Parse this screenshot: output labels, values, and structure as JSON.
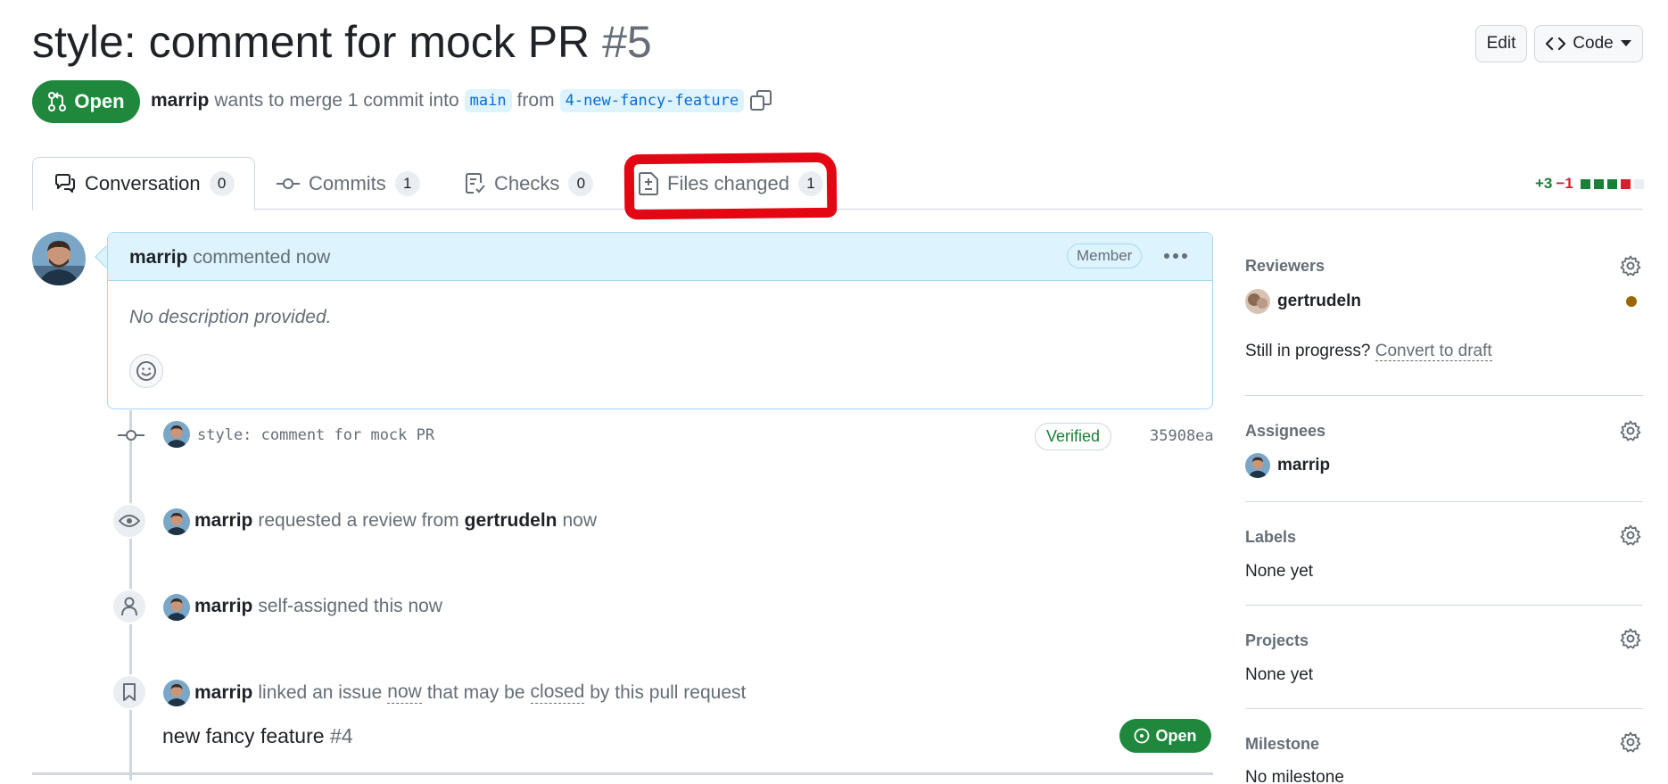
{
  "header": {
    "title": "style: comment for mock PR",
    "number": "#5",
    "edit_label": "Edit",
    "code_label": "Code",
    "state": "Open",
    "author": "marrip",
    "merge_text": "wants to merge 1 commit into",
    "base_branch": "main",
    "from_text": "from",
    "head_branch": "4-new-fancy-feature"
  },
  "tabs": [
    {
      "label": "Conversation",
      "count": "0"
    },
    {
      "label": "Commits",
      "count": "1"
    },
    {
      "label": "Checks",
      "count": "0"
    },
    {
      "label": "Files changed",
      "count": "1"
    }
  ],
  "diffstat": {
    "additions": "+3",
    "deletions": "−1"
  },
  "comment": {
    "author": "marrip",
    "action": "commented now",
    "role": "Member",
    "body": "No description provided."
  },
  "timeline": {
    "commit": {
      "message": "style: comment for mock PR",
      "status": "Verified",
      "sha": "35908ea"
    },
    "review_request": {
      "actor": "marrip",
      "text": "requested a review from",
      "reviewer": "gertrudeln",
      "time": "now"
    },
    "assign": {
      "actor": "marrip",
      "text": "self-assigned this now"
    },
    "linked_issue": {
      "actor": "marrip",
      "text1": "linked an issue",
      "time": "now",
      "text2": "that may be",
      "closed": "closed",
      "text3": "by this pull request",
      "issue_title": "new fancy feature",
      "issue_number": "#4",
      "issue_state": "Open"
    }
  },
  "sidebar": {
    "reviewers": {
      "title": "Reviewers",
      "name": "gertrudeln",
      "draft_prompt": "Still in progress?",
      "draft_link": "Convert to draft"
    },
    "assignees": {
      "title": "Assignees",
      "name": "marrip"
    },
    "labels": {
      "title": "Labels",
      "value": "None yet"
    },
    "projects": {
      "title": "Projects",
      "value": "None yet"
    },
    "milestone": {
      "title": "Milestone",
      "value": "No milestone"
    }
  },
  "colors": {
    "open_green": "#1f883d",
    "link_blue": "#0969da",
    "highlight_red": "#e30613",
    "pending_dot": "#9a6700"
  }
}
